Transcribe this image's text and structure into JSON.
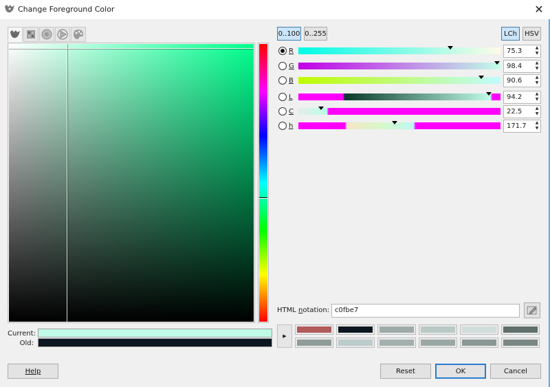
{
  "window": {
    "title": "Change Foreground Color",
    "close_glyph": "✕"
  },
  "selector_tabs": [
    {
      "icon": "gimp-wilber-icon",
      "active": true
    },
    {
      "icon": "cmyk-grid-icon",
      "active": false
    },
    {
      "icon": "color-circle-icon",
      "active": false
    },
    {
      "icon": "triangle-wheel-icon",
      "active": false
    },
    {
      "icon": "watercolor-palette-icon",
      "active": false
    }
  ],
  "colors": {
    "current": "#c0fbe7",
    "old": "#0b1620"
  },
  "labels": {
    "current": "Current:",
    "old": "Old:"
  },
  "range_buttons": {
    "r0_100": "0..100",
    "r0_255": "0..255"
  },
  "model_buttons": {
    "lch": "LCh",
    "hsv": "HSV"
  },
  "channels": [
    {
      "letter": "R",
      "value": "75.3",
      "selected": true,
      "fraction": 0.753
    },
    {
      "letter": "G",
      "value": "98.4",
      "selected": false,
      "fraction": 0.984
    },
    {
      "letter": "B",
      "value": "90.6",
      "selected": false,
      "fraction": 0.906
    },
    {
      "letter": "L",
      "value": "94.2",
      "selected": false,
      "fraction": 0.942
    },
    {
      "letter": "C",
      "value": "22.5",
      "selected": false,
      "fraction": 0.113
    },
    {
      "letter": "h",
      "value": "171.7",
      "selected": false,
      "fraction": 0.477
    }
  ],
  "html_notation": {
    "label_pre": "HTML ",
    "label_mnemonic": "n",
    "label_post": "otation:",
    "value": "c0fbe7"
  },
  "history_colors": [
    "#b05a5a",
    "#0b1620",
    "#9eaaa8",
    "#b8c9c6",
    "#d0dddb",
    "#5f6f6b",
    "#8f9c99",
    "#bccbcb",
    "#a3b0ae",
    "#9aa7a5",
    "#8a9794",
    "#7a8785"
  ],
  "buttons": {
    "help": "Help",
    "reset": "Reset",
    "ok": "OK",
    "cancel": "Cancel"
  }
}
